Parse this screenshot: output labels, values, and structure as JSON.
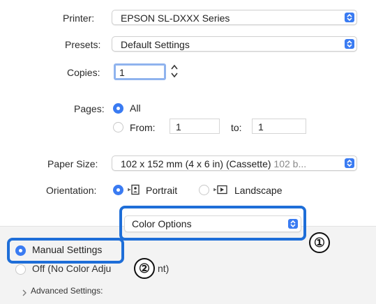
{
  "printer": {
    "label": "Printer:",
    "value": "EPSON SL-DXXX Series"
  },
  "presets": {
    "label": "Presets:",
    "value": "Default Settings"
  },
  "copies": {
    "label": "Copies:",
    "value": "1"
  },
  "pages": {
    "label": "Pages:",
    "all_label": "All",
    "from_label": "From:",
    "from_value": "1",
    "to_label": "to:",
    "to_value": "1"
  },
  "paper_size": {
    "label": "Paper Size:",
    "value": "102 x 152 mm (4 x 6 in) (Cassette)",
    "value_dim": "102 b..."
  },
  "orientation": {
    "label": "Orientation:",
    "portrait_label": "Portrait",
    "landscape_label": "Landscape"
  },
  "section_popup": {
    "value": "Color Options"
  },
  "color_mode": {
    "manual_label": "Manual Settings",
    "off_label_partial_left": "Off (No Color Adju",
    "off_label_partial_right": "nt)"
  },
  "advanced": {
    "label": "Advanced Settings:"
  },
  "callouts": {
    "one": "①",
    "two": "②"
  },
  "colors": {
    "accent": "#3a7bf2",
    "highlight": "#1e6ed8",
    "panel_bg": "#f3f3f3",
    "field_border": "#d5d5d5"
  },
  "icons": {
    "popup_arrows": "updown-chevron-icon",
    "stepper": "stepper-icon",
    "portrait": "portrait-orientation-icon",
    "landscape": "landscape-orientation-icon",
    "disclosure": "chevron-right-icon"
  }
}
